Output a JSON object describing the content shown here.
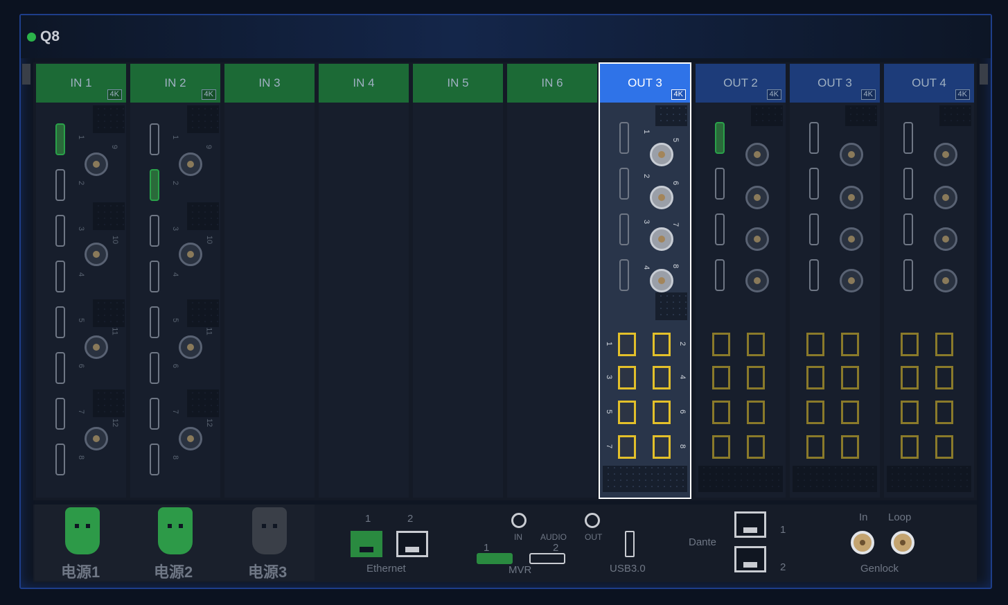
{
  "device": {
    "name": "Q8",
    "status_color": "#2bb34a"
  },
  "slots": [
    {
      "label": "IN 1",
      "type": "input",
      "badge": "4K",
      "populated": true
    },
    {
      "label": "IN 2",
      "type": "input",
      "badge": "4K",
      "populated": true
    },
    {
      "label": "IN 3",
      "type": "input",
      "badge": "",
      "populated": false
    },
    {
      "label": "IN 4",
      "type": "input",
      "badge": "",
      "populated": false
    },
    {
      "label": "IN 5",
      "type": "input",
      "badge": "",
      "populated": false
    },
    {
      "label": "IN 6",
      "type": "input",
      "badge": "",
      "populated": false
    },
    {
      "label": "OUT 3",
      "type": "output",
      "badge": "4K",
      "populated": true,
      "selected": true
    },
    {
      "label": "OUT 2",
      "type": "output",
      "badge": "4K",
      "populated": true
    },
    {
      "label": "OUT 3",
      "type": "output",
      "badge": "4K",
      "populated": true
    },
    {
      "label": "OUT 4",
      "type": "output",
      "badge": "4K",
      "populated": true
    }
  ],
  "input_port_numbers": {
    "hdmi": [
      "1",
      "2",
      "3",
      "4",
      "5",
      "6",
      "7",
      "8"
    ],
    "sdi": [
      "9",
      "10",
      "11",
      "12"
    ]
  },
  "output_port_numbers": {
    "hdmi": [
      "1",
      "2",
      "3",
      "4"
    ],
    "sdi": [
      "5",
      "6",
      "7",
      "8"
    ],
    "fiber": [
      "1",
      "2",
      "3",
      "4",
      "5",
      "6",
      "7",
      "8"
    ]
  },
  "power": [
    {
      "label": "电源1",
      "active": true
    },
    {
      "label": "电源2",
      "active": true
    },
    {
      "label": "电源3",
      "active": false
    }
  ],
  "ethernet": {
    "label": "Ethernet",
    "ports": [
      "1",
      "2"
    ]
  },
  "audio": {
    "label": "AUDIO",
    "in": "IN",
    "out": "OUT"
  },
  "mvr": {
    "label": "MVR",
    "ports": [
      "1",
      "2"
    ]
  },
  "usb": {
    "label": "USB3.0"
  },
  "dante": {
    "label": "Dante",
    "ports": [
      "1",
      "2"
    ]
  },
  "genlock": {
    "label": "Genlock",
    "in": "In",
    "loop": "Loop"
  },
  "colors": {
    "accent": "#2f73e8",
    "input": "#1c6a36",
    "output": "#1d3c7a",
    "fiber": "#e3c02a"
  }
}
